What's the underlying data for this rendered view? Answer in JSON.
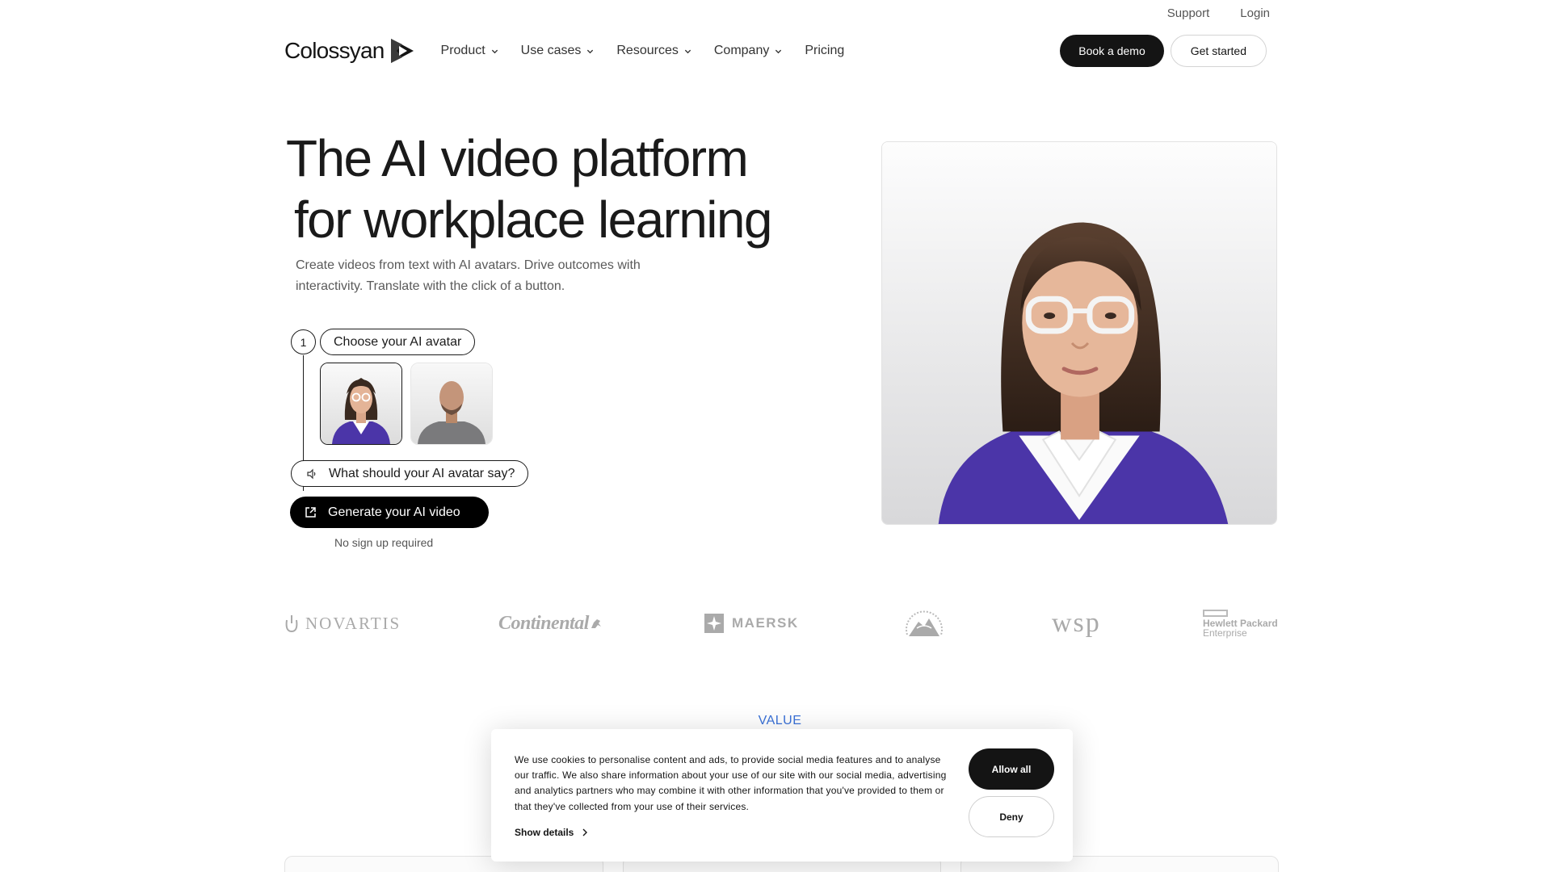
{
  "utility": {
    "support": "Support",
    "login": "Login"
  },
  "nav": {
    "logo_text": "Colossyan",
    "items": [
      {
        "label": "Product",
        "has_dropdown": true
      },
      {
        "label": "Use cases",
        "has_dropdown": true
      },
      {
        "label": "Resources",
        "has_dropdown": true
      },
      {
        "label": "Company",
        "has_dropdown": true
      },
      {
        "label": "Pricing",
        "has_dropdown": false
      }
    ],
    "book_demo": "Book a demo",
    "get_started": "Get started"
  },
  "hero": {
    "headline_line1": "The AI video platform",
    "headline_line2": "for workplace learning",
    "subtext": "Create videos from text with AI avatars. Drive outcomes with interactivity. Translate with the click of a button.",
    "step_number": "1",
    "step_choose": "Choose your AI avatar",
    "avatars": [
      {
        "name": "female-avatar",
        "selected": true
      },
      {
        "name": "male-avatar",
        "selected": false
      }
    ],
    "say_placeholder": "What should your AI avatar say?",
    "generate_button": "Generate your AI video",
    "no_signup": "No sign up required"
  },
  "logos": {
    "novartis": "NOVARTIS",
    "continental": "Continental",
    "maersk": "MAERSK",
    "wsp": "wsp",
    "hpe_line1": "Hewlett Packard",
    "hpe_line2": "Enterprise"
  },
  "value_label": "VALUE",
  "cookie": {
    "text": "We use cookies to personalise content and ads, to provide social media features and to analyse our traffic. We also share information about your use of our site with our social media, advertising and analytics partners who may combine it with other information that you've provided to them or that they've collected from your use of their services.",
    "show_details": "Show details",
    "allow_all": "Allow all",
    "deny": "Deny"
  },
  "colors": {
    "accent_blue": "#3a71d8",
    "dark": "#141414",
    "sweater_purple": "#4b35a8"
  }
}
